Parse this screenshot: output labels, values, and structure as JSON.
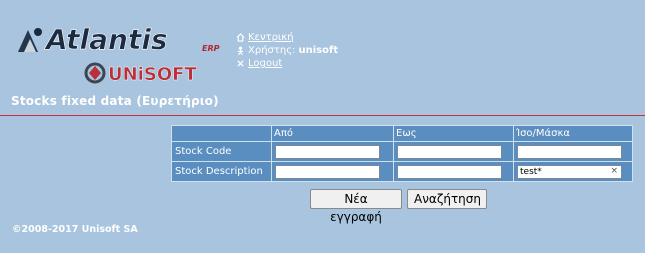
{
  "logos": {
    "atlantis": "Atlantis",
    "atlantis_suffix": "ERP",
    "unisoft": "UNiSOFT"
  },
  "header": {
    "home_link": "Κεντρική",
    "user_label": "Χρήστης:",
    "user_name": "unisoft",
    "logout_link": "Logout"
  },
  "page": {
    "title": "Stocks fixed data (Ευρετήριο)"
  },
  "form": {
    "columns": [
      "",
      "Από",
      "Εως",
      "Ίσο/Μάσκα"
    ],
    "rows": [
      {
        "label": "Stock Code",
        "from": "",
        "to": "",
        "mask": ""
      },
      {
        "label": "Stock Description",
        "from": "",
        "to": "",
        "mask": "test*"
      }
    ],
    "clear_glyph": "×"
  },
  "buttons": {
    "new_record": "Νέα εγγραφή",
    "search": "Αναζήτηση"
  },
  "footer": {
    "copyright": "©2008-2017 Unisoft SA"
  },
  "colors": {
    "background": "#a8c4de",
    "table_cell": "#5a8ec0",
    "rule": "#c4343c"
  }
}
